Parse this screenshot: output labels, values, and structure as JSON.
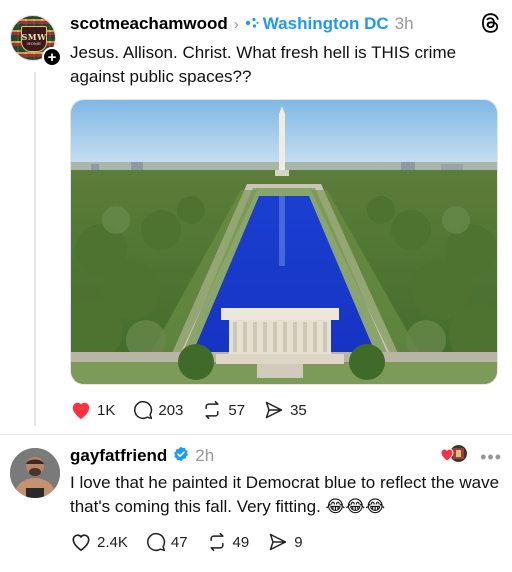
{
  "post": {
    "username": "scotmeachamwood",
    "topic": "Washington DC",
    "time": "3h",
    "avatar_text": "SMW",
    "avatar_subtext": "HOME",
    "text": "Jesus. Allison. Christ. What fresh hell is THIS crime against public spaces??",
    "stats": {
      "likes": "1K",
      "comments": "203",
      "reposts": "57",
      "shares": "35"
    },
    "liked": true
  },
  "reply": {
    "username": "gayfatfriend",
    "verified": true,
    "time": "2h",
    "text": "I love that he painted it Democrat blue to reflect the wave that's coming this fall. Very fitting. 😂😂😂",
    "stats": {
      "likes": "2.4K",
      "comments": "47",
      "reposts": "49",
      "shares": "9"
    }
  },
  "colors": {
    "accent": "#1d9bf0",
    "like": "#ff3040",
    "pool_blue": "#1a3fd0"
  },
  "icons": [
    "plus-icon",
    "chevron-right-icon",
    "topic-dots-icon",
    "threads-logo-icon",
    "heart-icon",
    "comment-icon",
    "repost-icon",
    "share-icon",
    "verified-badge-icon",
    "more-icon"
  ]
}
